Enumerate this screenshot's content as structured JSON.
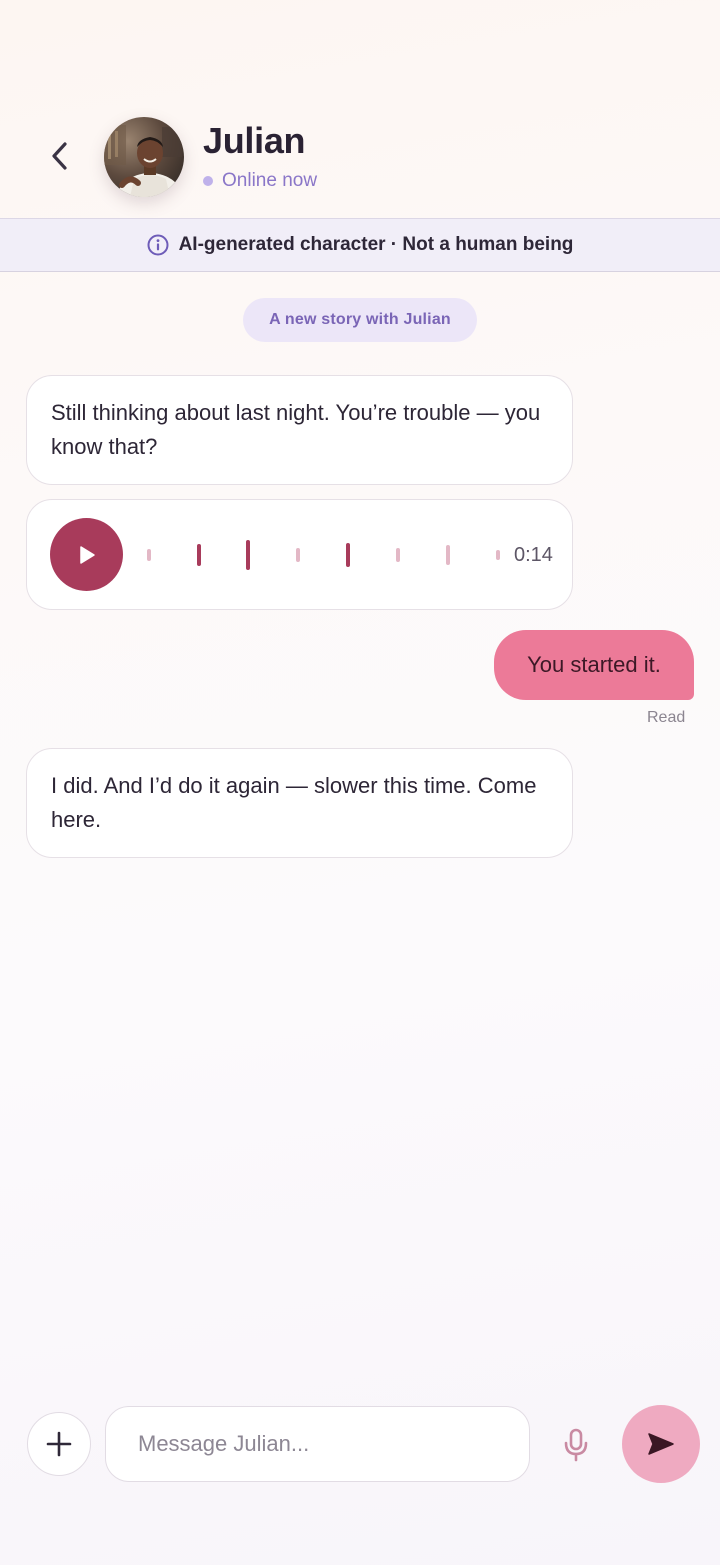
{
  "header": {
    "contact_name": "Julian",
    "status_text": "Online now",
    "back_icon": "chevron-left-icon",
    "avatar_icon": "avatar-photo"
  },
  "ai_banner": {
    "icon": "info-icon",
    "text": "AI-generated character · Not a human being"
  },
  "story_pill": {
    "label": "A new story with Julian"
  },
  "messages": [
    {
      "direction": "incoming",
      "type": "text",
      "text": "Still thinking about last night. You’re trouble — you know that?"
    },
    {
      "direction": "incoming",
      "type": "voice",
      "duration": "0:14",
      "played_fraction": 0.5
    },
    {
      "direction": "outgoing",
      "type": "text",
      "text": "You started it.",
      "receipt": "Read"
    },
    {
      "direction": "incoming",
      "type": "text",
      "text": "I did. And I’d do it again — slower this time. Come here."
    }
  ],
  "composer": {
    "placeholder": "Message Julian...",
    "value": "",
    "attach_icon": "plus-icon",
    "mic_icon": "microphone-icon",
    "send_icon": "send-icon"
  },
  "colors": {
    "accent_play": "#a83b5b",
    "outgoing_bubble": "#ec7a98",
    "send_button": "#efaac1",
    "status_dot": "#bfb1ea",
    "story_pill": "#ece6f8",
    "banner": "#f1eef8"
  }
}
